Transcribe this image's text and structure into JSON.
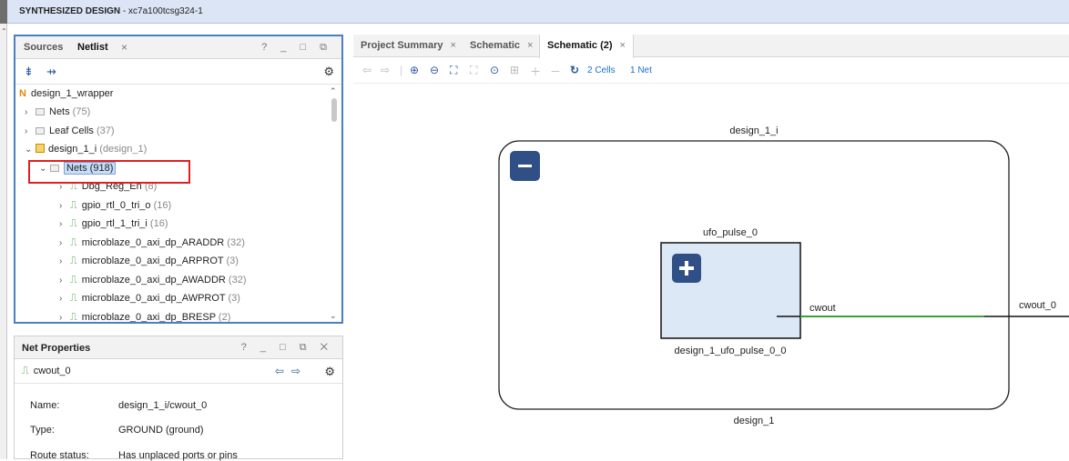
{
  "window": {
    "title_bold": "SYNTHESIZED DESIGN",
    "title_rest": " - xc7a100tcsg324-1"
  },
  "netlist_panel": {
    "tabs": [
      "Sources",
      "Netlist"
    ],
    "close": "×",
    "controls": "? _ □ ⧉",
    "tree": [
      {
        "label": "design_1_wrapper",
        "count": ""
      },
      {
        "label": "Nets",
        "count": " (75)"
      },
      {
        "label": "Leaf Cells",
        "count": " (37)"
      },
      {
        "label": "design_1_i",
        "count": " (design_1)"
      },
      {
        "label": "Nets (918)",
        "count": ""
      },
      {
        "label": "Dbg_Reg_En",
        "count": " (8)"
      },
      {
        "label": "gpio_rtl_0_tri_o",
        "count": " (16)"
      },
      {
        "label": "gpio_rtl_1_tri_i",
        "count": " (16)"
      },
      {
        "label": "microblaze_0_axi_dp_ARADDR",
        "count": " (32)"
      },
      {
        "label": "microblaze_0_axi_dp_ARPROT",
        "count": " (3)"
      },
      {
        "label": "microblaze_0_axi_dp_AWADDR",
        "count": " (32)"
      },
      {
        "label": "microblaze_0_axi_dp_AWPROT",
        "count": " (3)"
      },
      {
        "label": "microblaze_0_axi_dp_BRESP",
        "count": " (2)"
      }
    ]
  },
  "net_properties": {
    "title": "Net Properties",
    "controls": "? _ □ ⧉ ✕",
    "net_name": "cwout_0",
    "rows": [
      {
        "key": "Name:",
        "value": "design_1_i/cwout_0"
      },
      {
        "key": "Type:",
        "value": "GROUND (ground)"
      },
      {
        "key": "Route status:",
        "value": "Has unplaced ports or pins"
      }
    ]
  },
  "editor_tabs": [
    {
      "label": "Project Summary"
    },
    {
      "label": "Schematic"
    },
    {
      "label": "Schematic (2)"
    }
  ],
  "schematic_toolbar": {
    "cells": "2 Cells",
    "nets": "1 Net"
  },
  "schematic": {
    "outer_title": "design_1_i",
    "outer_bottom": "design_1",
    "inner_title": "ufo_pulse_0",
    "inner_bottom": "design_1_ufo_pulse_0_0",
    "pin_label": "cwout",
    "port_label": "cwout_0",
    "colors": {
      "box_fill": "#dde8f7",
      "button": "#2f4f86",
      "net_wire": "#3aa03a"
    }
  }
}
